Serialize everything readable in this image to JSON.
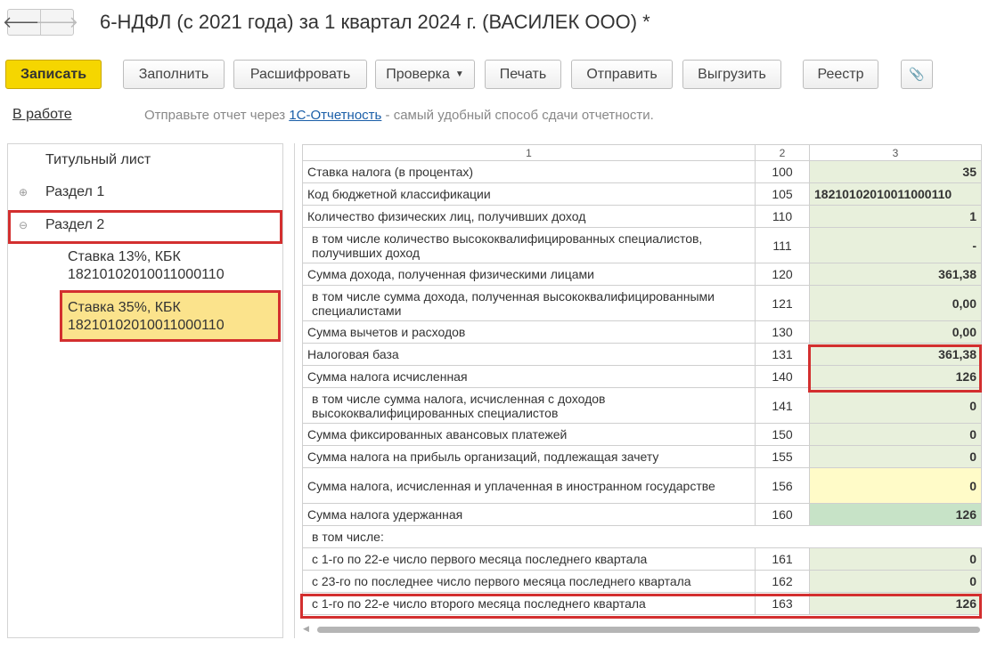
{
  "window": {
    "title": "6-НДФЛ (с 2021 года) за 1 квартал 2024 г. (ВАСИЛЕК ООО) *",
    "back_glyph": "🡐",
    "fwd_glyph": "🡒"
  },
  "toolbar": {
    "save": "Записать",
    "fill": "Заполнить",
    "decode": "Расшифровать",
    "check": "Проверка",
    "print": "Печать",
    "send": "Отправить",
    "export": "Выгрузить",
    "registry": "Реестр",
    "attach_glyph": "📎"
  },
  "status": {
    "state": "В работе",
    "hint_prefix": "Отправьте отчет через ",
    "hint_link": "1С-Отчетность",
    "hint_suffix": " - самый удобный способ сдачи отчетности."
  },
  "tree": {
    "title_page": "Титульный лист",
    "section1": "Раздел 1",
    "section2": "Раздел 2",
    "rate13_line1": "Ставка 13%, КБК",
    "rate13_line2": "18210102010011000110",
    "rate35_line1": "Ставка 35%, КБК",
    "rate35_line2": "18210102010011000110",
    "plus_glyph": "⊕",
    "minus_glyph": "⊖"
  },
  "table": {
    "headers": [
      "1",
      "2",
      "3"
    ],
    "rows": [
      {
        "label": "Ставка налога (в процентах)",
        "code": "100",
        "value": "35"
      },
      {
        "label": "Код бюджетной классификации",
        "code": "105",
        "value": "18210102010011000110"
      },
      {
        "label": "Количество физических лиц, получивших доход",
        "code": "110",
        "value": "1"
      },
      {
        "label": "в том числе количество высококвалифицированных специалистов, получивших доход",
        "code": "111",
        "value": "-"
      },
      {
        "label": "Сумма дохода, полученная физическими лицами",
        "code": "120",
        "value": "361,38"
      },
      {
        "label": "в том числе сумма дохода, полученная высококвалифицированными специалистами",
        "code": "121",
        "value": "0,00"
      },
      {
        "label": "Сумма вычетов и расходов",
        "code": "130",
        "value": "0,00"
      },
      {
        "label": "Налоговая база",
        "code": "131",
        "value": "361,38"
      },
      {
        "label": "Сумма налога исчисленная",
        "code": "140",
        "value": "126"
      },
      {
        "label": "в том числе сумма налога, исчисленная с доходов высококвалифицированных специалистов",
        "code": "141",
        "value": "0"
      },
      {
        "label": "Сумма фиксированных авансовых платежей",
        "code": "150",
        "value": "0"
      },
      {
        "label": "Сумма налога на прибыль организаций, подлежащая зачету",
        "code": "155",
        "value": "0"
      },
      {
        "label": "Сумма налога, исчисленная и уплаченная в иностранном государстве",
        "code": "156",
        "value": "0"
      },
      {
        "label": "Сумма налога удержанная",
        "code": "160",
        "value": "126"
      },
      {
        "label": "в том числе:",
        "code": "",
        "value": ""
      },
      {
        "label": "с 1-го по 22-е число первого месяца последнего квартала",
        "code": "161",
        "value": "0"
      },
      {
        "label": "с 23-го по последнее число первого месяца последнего квартала",
        "code": "162",
        "value": "0"
      },
      {
        "label": "с 1-го по 22-е число второго месяца последнего квартала",
        "code": "163",
        "value": "126"
      }
    ]
  },
  "colors": {
    "accent_yellow": "#f5d600",
    "highlight_red": "#d32f2f",
    "cell_green": "#e8f0dc",
    "cell_dark_green": "#c7e3c7",
    "cell_yellow": "#fffbc8",
    "selected_item": "#fbe38c"
  }
}
